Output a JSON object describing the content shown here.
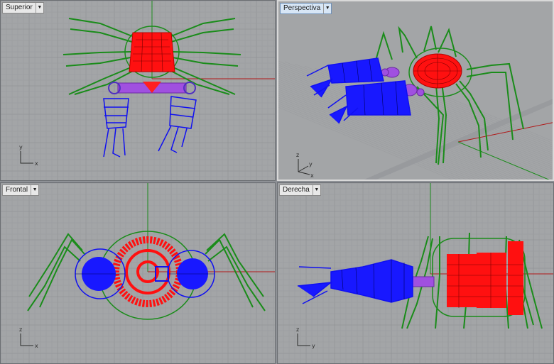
{
  "viewports": [
    {
      "id": "top",
      "label": "Superior",
      "axes": [
        "x",
        "y"
      ],
      "active": false
    },
    {
      "id": "persp",
      "label": "Perspectiva",
      "axes": [
        "x",
        "y",
        "z"
      ],
      "active": true
    },
    {
      "id": "front",
      "label": "Frontal",
      "axes": [
        "x",
        "z"
      ],
      "active": false
    },
    {
      "id": "right",
      "label": "Derecha",
      "axes": [
        "y",
        "z"
      ],
      "active": false
    }
  ],
  "icons": {
    "dropdown": "chevron-down-icon"
  },
  "colors": {
    "viewport_bg": "#a3a5a7",
    "grid_minor": "#999b9e",
    "grid_major": "#8a8c8f",
    "axis_x": "#b01818",
    "axis_y": "#1c8a1c",
    "body": "#ff0000",
    "legs": "#1a8c1a",
    "arms": "#1010f0",
    "joints": "#a050e0"
  }
}
